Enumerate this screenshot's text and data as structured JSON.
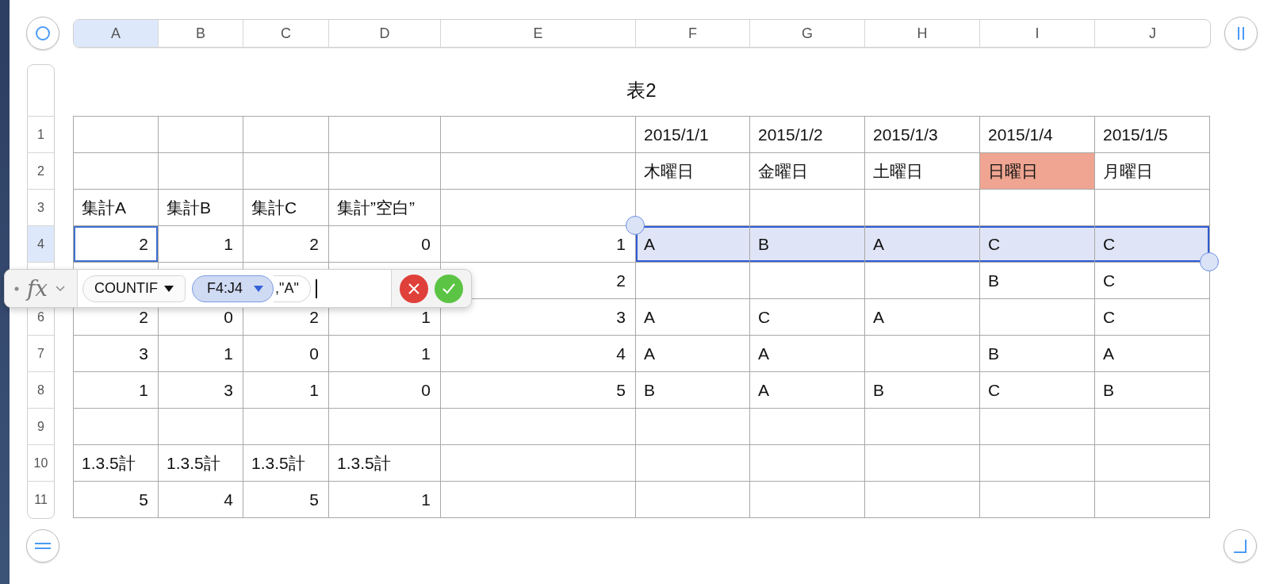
{
  "column_headers": [
    {
      "label": "A",
      "selected": true
    },
    {
      "label": "B",
      "selected": false
    },
    {
      "label": "C",
      "selected": false
    },
    {
      "label": "D",
      "selected": false
    },
    {
      "label": "E",
      "selected": false
    },
    {
      "label": "F",
      "selected": false
    },
    {
      "label": "G",
      "selected": false
    },
    {
      "label": "H",
      "selected": false
    },
    {
      "label": "I",
      "selected": false
    },
    {
      "label": "J",
      "selected": false
    }
  ],
  "table": {
    "title": "表2",
    "rows": [
      {
        "label": "1",
        "selected": false,
        "kind": "text",
        "cells": [
          null,
          null,
          null,
          null,
          null,
          "2015/1/1",
          "2015/1/2",
          "2015/1/3",
          "2015/1/4",
          "2015/1/5"
        ]
      },
      {
        "label": "2",
        "selected": false,
        "kind": "text",
        "cells": [
          null,
          null,
          null,
          null,
          null,
          "木曜日",
          "金曜日",
          "土曜日",
          {
            "text": "日曜日",
            "color": "#efa591"
          },
          "月曜日"
        ]
      },
      {
        "label": "3",
        "selected": false,
        "kind": "text",
        "cells": [
          "集計A",
          "集計B",
          "集計C",
          "集計”空白”",
          null,
          null,
          null,
          null,
          null,
          null
        ]
      },
      {
        "label": "4",
        "selected": true,
        "kind": "number",
        "cells": [
          {
            "text": "2",
            "editing": true
          },
          "1",
          "2",
          "0",
          "1",
          {
            "text": "A",
            "in_range": true
          },
          {
            "text": "B",
            "in_range": true
          },
          {
            "text": "A",
            "in_range": true
          },
          {
            "text": "C",
            "in_range": true
          },
          {
            "text": "C",
            "in_range": true
          }
        ]
      },
      {
        "kind": "number",
        "cells": [
          null,
          null,
          null,
          null,
          "2",
          null,
          null,
          null,
          "B",
          "C"
        ]
      },
      {
        "label": "6",
        "selected": false,
        "kind": "number",
        "cells": [
          "2",
          "0",
          "2",
          "1",
          "3",
          "A",
          "C",
          "A",
          null,
          "C"
        ]
      },
      {
        "label": "7",
        "selected": false,
        "kind": "number",
        "cells": [
          "3",
          "1",
          "0",
          "1",
          "4",
          "A",
          "A",
          null,
          "B",
          "A"
        ]
      },
      {
        "label": "8",
        "selected": false,
        "kind": "number",
        "cells": [
          "1",
          "3",
          "1",
          "0",
          "5",
          "B",
          "A",
          "B",
          "C",
          "B"
        ]
      },
      {
        "label": "9",
        "selected": false,
        "cells": [
          null,
          null,
          null,
          null,
          null,
          null,
          null,
          null,
          null,
          null
        ]
      },
      {
        "label": "10",
        "selected": false,
        "kind": "text",
        "cells": [
          "1.3.5計",
          "1.3.5計",
          "1.3.5計",
          "1.3.5計",
          null,
          null,
          null,
          null,
          null,
          null
        ]
      },
      {
        "label": "11",
        "selected": false,
        "kind": "number",
        "cells": [
          "5",
          "4",
          "5",
          "1",
          null,
          null,
          null,
          null,
          null,
          null
        ]
      }
    ]
  },
  "formula_bar": {
    "fx": "fx",
    "tokens": [
      {
        "kind": "function",
        "text": "COUNTIF"
      },
      {
        "kind": "range",
        "text": "F4:J4"
      },
      {
        "kind": "text",
        "text": ",\"A\""
      }
    ]
  }
}
